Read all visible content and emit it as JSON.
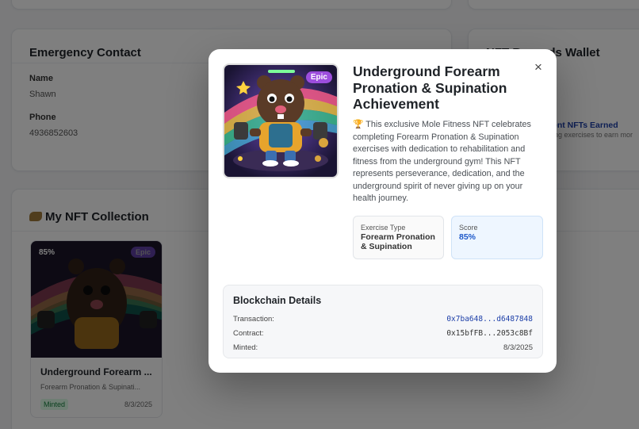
{
  "background": {
    "emergency_contact": {
      "title": "Emergency Contact",
      "name_label": "Name",
      "name_value": "Shawn",
      "phone_label": "Phone",
      "phone_value": "4936852603"
    },
    "wallet": {
      "title": "NFT Rewards Wallet",
      "count_text": "ent NFTs Earned",
      "hint_text": "ing exercises to earn mor"
    },
    "collection": {
      "title": "My NFT Collection",
      "icon": "sparkle-icon",
      "card": {
        "score": "85%",
        "rarity": "Epic",
        "title": "Underground Forearm ...",
        "subtitle": "Forearm Pronation & Supinati...",
        "status": "Minted",
        "date": "8/3/2025"
      }
    }
  },
  "modal": {
    "close_icon": "×",
    "rarity": "Epic",
    "title": "Underground Forearm Pronation & Supination Achievement",
    "description": "🏆 This exclusive Mole Fitness NFT celebrates completing Forearm Pronation & Supination exercises with dedication to rehabilitation and fitness from the underground gym! This NFT represents perseverance, dedication, and the underground spirit of never giving up on your health journey.",
    "exercise_type_label": "Exercise Type",
    "exercise_type_value": "Forearm Pronation & Supination",
    "score_label": "Score",
    "score_value": "85%",
    "blockchain": {
      "title": "Blockchain Details",
      "transaction_label": "Transaction:",
      "transaction_value": "0x7ba648...d6487848",
      "contract_label": "Contract:",
      "contract_value": "0x15bfFB...2053c8Bf",
      "minted_label": "Minted:",
      "minted_value": "8/3/2025"
    }
  },
  "colors": {
    "rarity_epic": "#9d4edd",
    "score_blue": "#1d58c9",
    "tx_link": "#1d3fa8",
    "overlay": "rgba(0,0,0,0.5)"
  }
}
